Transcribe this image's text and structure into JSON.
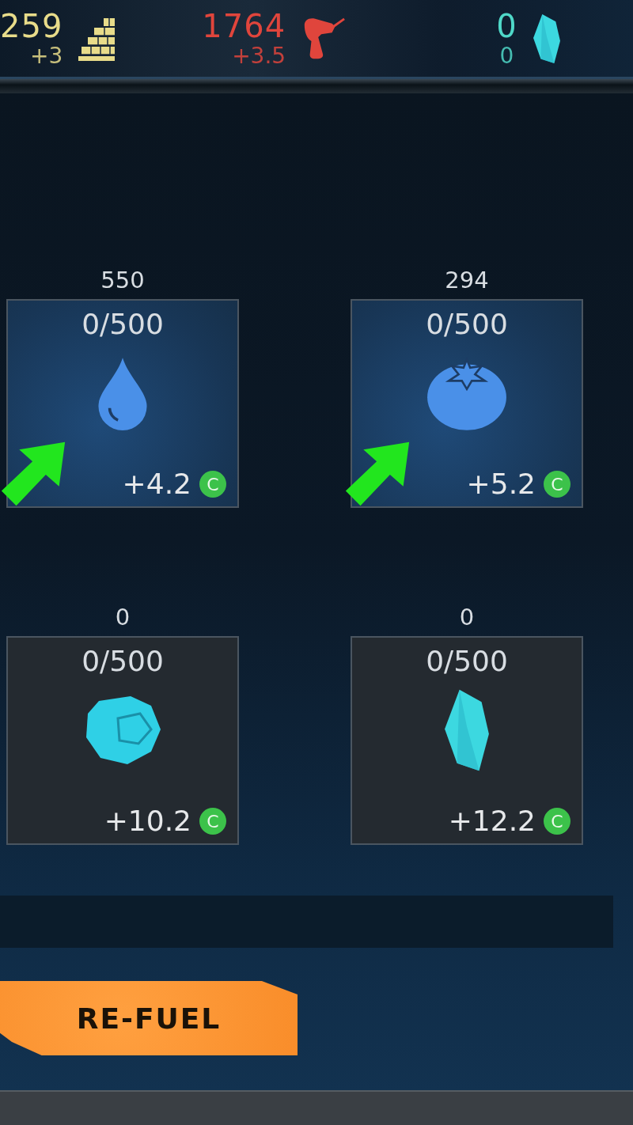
{
  "resources": [
    {
      "kind": "bricks",
      "amount": "259",
      "change": "+3",
      "color": "#e8dc8a"
    },
    {
      "kind": "drill",
      "amount": "1764",
      "change": "+3.5",
      "color": "#e0453c"
    },
    {
      "kind": "crystal",
      "amount": "0",
      "change": "0",
      "color": "#4fd8c8"
    }
  ],
  "fuel_slots": [
    {
      "kind": "water",
      "stock": "550",
      "capacity": "0/500",
      "rate": "+4.2",
      "coin": "C",
      "active": true
    },
    {
      "kind": "tomato",
      "stock": "294",
      "capacity": "0/500",
      "rate": "+5.2",
      "coin": "C",
      "active": true
    },
    {
      "kind": "ore",
      "stock": "0",
      "capacity": "0/500",
      "rate": "+10.2",
      "coin": "C",
      "active": false
    },
    {
      "kind": "crystal",
      "stock": "0",
      "capacity": "0/500",
      "rate": "+12.2",
      "coin": "C",
      "active": false
    }
  ],
  "refuel_button": {
    "label": "RE-FUEL"
  }
}
